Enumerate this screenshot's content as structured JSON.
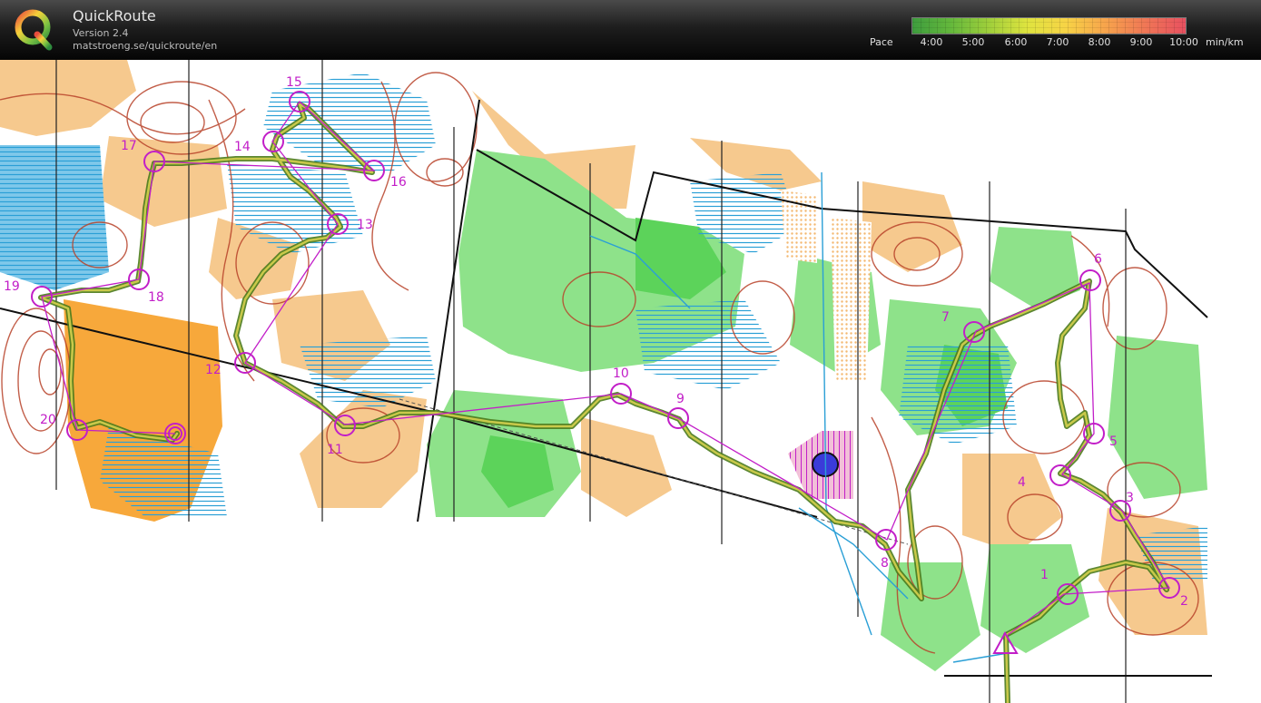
{
  "app": {
    "name": "QuickRoute",
    "version": "Version 2.4",
    "url": "matstroeng.se/quickroute/en"
  },
  "pace_legend": {
    "label": "Pace",
    "ticks": [
      "4:00",
      "5:00",
      "6:00",
      "7:00",
      "8:00",
      "9:00",
      "10:00"
    ],
    "unit": "min/km",
    "colors": [
      "#3e9c3e",
      "#64b83c",
      "#9fcf3b",
      "#dfe43f",
      "#f7d446",
      "#f7a64c",
      "#e85060"
    ]
  },
  "course": {
    "color": "#c21ec8",
    "controls": [
      "1",
      "2",
      "3",
      "4",
      "5",
      "6",
      "7",
      "8",
      "9",
      "10",
      "11",
      "12",
      "13",
      "14",
      "15",
      "16",
      "17",
      "18",
      "19",
      "20"
    ]
  }
}
